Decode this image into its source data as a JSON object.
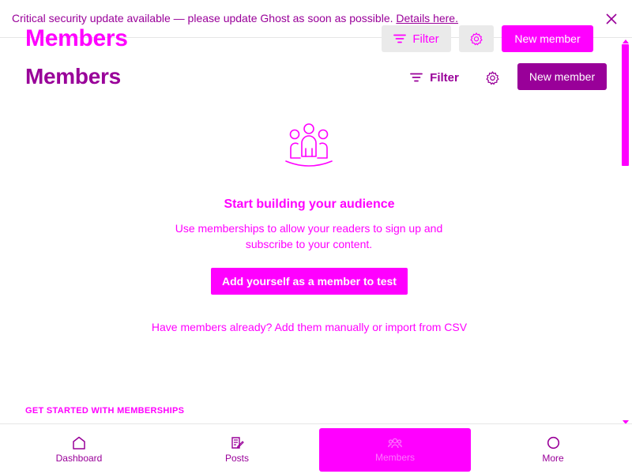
{
  "banner": {
    "message": "Critical security update available — please update Ghost as soon as possible.",
    "link": "Details here."
  },
  "header": {
    "title": "Members",
    "filter_label": "Filter",
    "new_member_label": "New member"
  },
  "empty_state": {
    "heading": "Start building your audience",
    "description": "Use memberships to allow your readers to sign up and subscribe to your content.",
    "add_self_label": "Add yourself as a member to test",
    "have_members_prefix": "Have members already?",
    "add_manually": "Add them manually",
    "or": "or",
    "import_csv": "import from CSV"
  },
  "get_started": "GET STARTED WITH MEMBERSHIPS",
  "bottom_nav": {
    "items": [
      {
        "label": "Dashboard",
        "icon": "home-icon"
      },
      {
        "label": "Posts",
        "icon": "posts-icon"
      },
      {
        "label": "Members",
        "icon": "members-icon"
      },
      {
        "label": "More",
        "icon": "circle-icon"
      }
    ]
  },
  "colors": {
    "accent": "#ff00ff",
    "accent_dark": "#990099"
  }
}
